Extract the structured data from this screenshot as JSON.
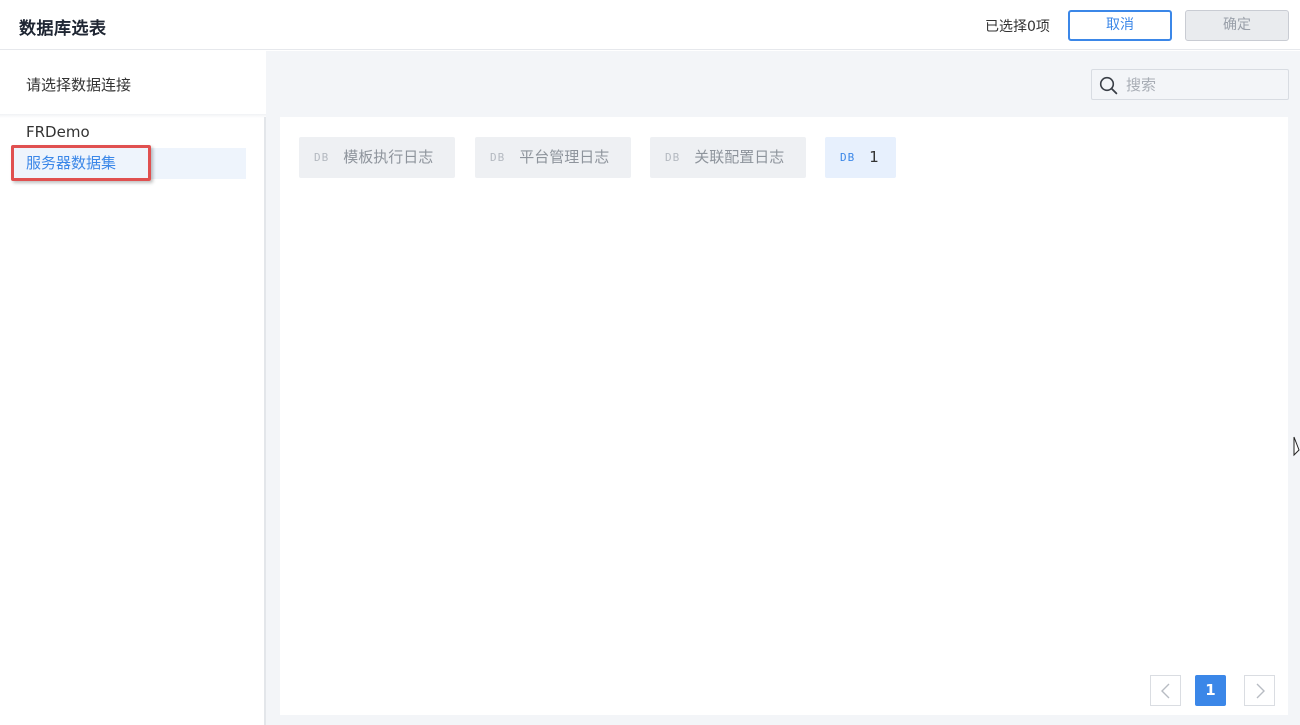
{
  "header": {
    "title": "数据库选表",
    "selected_count": "已选择0项",
    "cancel_label": "取消",
    "confirm_label": "确定"
  },
  "sidebar": {
    "heading": "请选择数据连接",
    "items": [
      {
        "label": "FRDemo"
      },
      {
        "label": "服务器数据集"
      }
    ]
  },
  "search": {
    "placeholder": "搜索",
    "icon": "search-icon"
  },
  "tables": [
    {
      "badge": "DB",
      "label": "模板执行日志"
    },
    {
      "badge": "DB",
      "label": "平台管理日志"
    },
    {
      "badge": "DB",
      "label": "关联配置日志"
    },
    {
      "badge": "DB",
      "label": "1"
    }
  ],
  "pagination": {
    "current_page": "1"
  },
  "colors": {
    "accent": "#3b87e8",
    "annotation": "#e05050"
  }
}
